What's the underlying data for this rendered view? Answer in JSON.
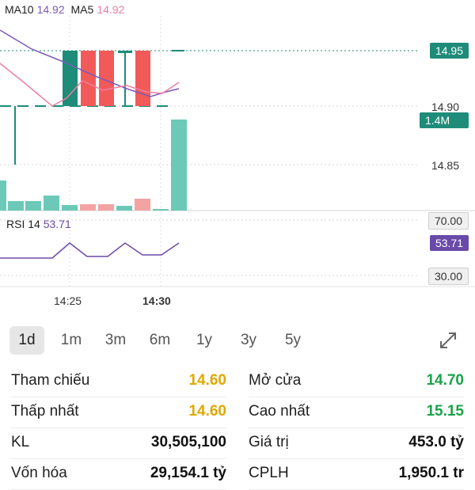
{
  "legend": {
    "ma10_label": "MA10",
    "ma10_value": "14.92",
    "ma5_label": "MA5",
    "ma5_value": "14.92",
    "ma10_color": "#7a5ab8",
    "ma5_color": "#ee7fa0"
  },
  "price_axis": {
    "current_price": "14.95",
    "tick_1": "14.90",
    "volume_tag": "1.4M",
    "tick_2": "14.85"
  },
  "rsi": {
    "label": "RSI 14",
    "value": "53.71",
    "upper": "70.00",
    "current": "53.71",
    "lower": "30.00"
  },
  "time_axis": {
    "t1": "14:25",
    "t2": "14:30"
  },
  "tabs": [
    "1d",
    "1m",
    "3m",
    "6m",
    "1y",
    "3y",
    "5y"
  ],
  "active_tab": "1d",
  "stats": {
    "ref_label": "Tham chiếu",
    "ref_value": "14.60",
    "open_label": "Mở cửa",
    "open_value": "14.70",
    "low_label": "Thấp nhất",
    "low_value": "14.60",
    "high_label": "Cao nhất",
    "high_value": "15.15",
    "vol_label": "KL",
    "vol_value": "30,505,100",
    "val_label": "Giá trị",
    "val_value": "453.0 tỷ",
    "cap_label": "Vốn hóa",
    "cap_value": "29,154.1 tỷ",
    "shares_label": "CPLH",
    "shares_value": "1,950.1 tr"
  },
  "colors": {
    "up": "#1e8c78",
    "down": "#f25a5a",
    "vol_up": "#6cc9b8",
    "vol_down": "#f4a3a3",
    "accent": "#1e8c78",
    "rsi_line": "#6a4aa8"
  },
  "chart_data": {
    "type": "candlestick",
    "candles": [
      {
        "open": 14.95,
        "close": 14.9,
        "high": 14.95,
        "low": 14.84,
        "dir": "up"
      },
      {
        "open": 14.95,
        "close": 14.9,
        "high": 14.95,
        "low": 14.9,
        "dir": "down"
      },
      {
        "open": 14.95,
        "close": 14.9,
        "high": 14.95,
        "low": 14.9,
        "dir": "down"
      },
      {
        "open": 14.95,
        "close": 14.95,
        "high": 14.95,
        "low": 14.9,
        "dir": "up"
      },
      {
        "open": 14.95,
        "close": 14.9,
        "high": 14.95,
        "low": 14.9,
        "dir": "down"
      },
      {
        "open": 14.95,
        "close": 14.95,
        "high": 14.95,
        "low": 14.95,
        "dir": "up"
      }
    ],
    "volume_bars": [
      0.42,
      0.13,
      0.13,
      0.21,
      0.08,
      0.08,
      0.06,
      0.16,
      0.01,
      1.0
    ],
    "rsi_values": [
      45,
      45,
      46,
      48,
      60,
      45,
      45,
      58,
      45,
      45,
      54
    ]
  }
}
